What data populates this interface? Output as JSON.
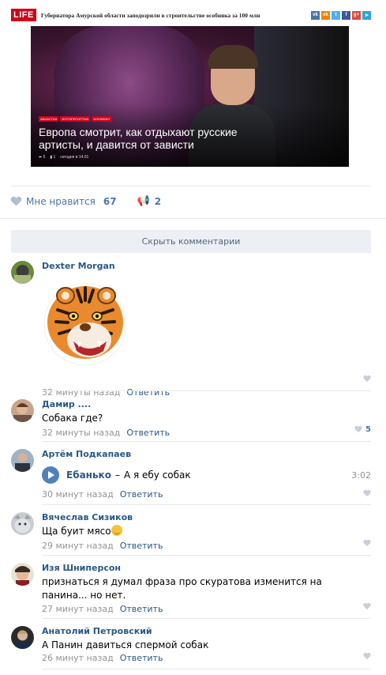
{
  "news": {
    "logo": "LIFE",
    "headline": "Губернатора Амурской области заподозрили в строительстве особняка за 100 млн",
    "share": [
      {
        "icon": "vk-icon",
        "label": "vk",
        "color": "#4a76a8"
      },
      {
        "icon": "odnoklassniki-icon",
        "label": "ok",
        "color": "#ee8208"
      },
      {
        "icon": "twitter-icon",
        "label": "t",
        "color": "#55acee"
      },
      {
        "icon": "facebook-icon",
        "label": "f",
        "color": "#3b5998"
      },
      {
        "icon": "googleplus-icon",
        "label": "g+",
        "color": "#dd4b39"
      },
      {
        "icon": "telegram-icon",
        "label": "➤",
        "color": "#2ca5e0"
      }
    ],
    "tags": [
      "АВИАСТАН",
      "ФОТОРЕПОРТАЖ",
      "КОНФЛИКТ"
    ],
    "title": "Европа смотрит, как отдыхают русские артисты, и давится от зависти",
    "meta": [
      "➦ 5",
      "▮ 1",
      "сегодня в 14:01"
    ]
  },
  "reactions": {
    "like_label": "Мне нравится",
    "like_count": "67",
    "repost_count": "2"
  },
  "hide_comments_label": "Скрыть комментарии",
  "comments": [
    {
      "author": "Dexter Morgan",
      "time": "32 минуты назад",
      "reply": "Ответить",
      "likes": ""
    },
    {
      "author": "Дамир ....",
      "text": "Собака где?",
      "time": "32 минуты назад",
      "reply": "Ответить",
      "likes": "5"
    },
    {
      "author": "Артём Подкапаев",
      "audio_artist": "Ебанько",
      "audio_dash": "–",
      "audio_title": "А я ебу собак",
      "audio_duration": "3:02",
      "time": "30 минут назад",
      "reply": "Ответить",
      "likes": ""
    },
    {
      "author": "Вячеслав Сизиков",
      "text": "Ща буит мясо",
      "time": "29 минут назад",
      "reply": "Ответить",
      "likes": ""
    },
    {
      "author": "Изя Шниперсон",
      "text": "признаться я думал фраза про скуратова изменится на панина... но нет.",
      "time": "27 минут назад",
      "reply": "Ответить",
      "likes": ""
    },
    {
      "author": "Анатолий Петровский",
      "text": "А Панин давиться спермой собак",
      "time": "26 минут назад",
      "reply": "Ответить",
      "likes": ""
    }
  ],
  "colors": {
    "link": "#2a5885",
    "accent": "#4a76a8",
    "muted": "#939393",
    "life_red": "#d0021b"
  }
}
